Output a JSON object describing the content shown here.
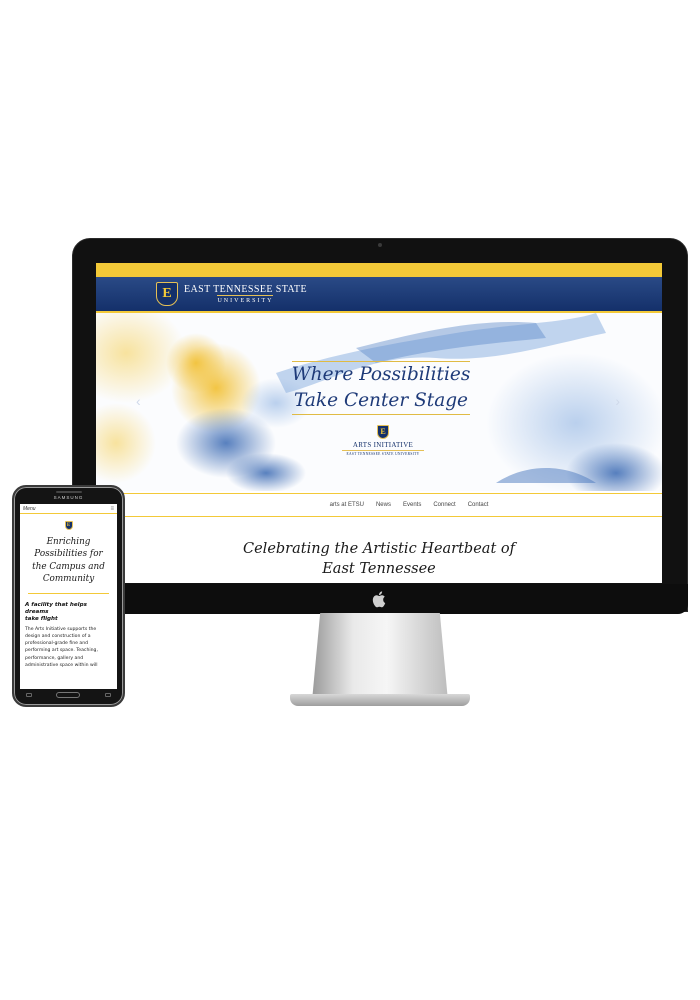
{
  "desktop_site": {
    "logo": {
      "mark": "E",
      "name": "EAST TENNESSEE STATE",
      "university": "UNIVERSITY"
    },
    "hero": {
      "headline_line1": "Where Possibilities",
      "headline_line2": "Take Center Stage",
      "arts_mark": "E",
      "arts_name": "ARTS INITIATIVE",
      "arts_sub": "EAST TENNESSEE STATE UNIVERSITY",
      "prev_arrow": "‹",
      "next_arrow": "›"
    },
    "nav": [
      "arts at ETSU",
      "News",
      "Events",
      "Connect",
      "Contact"
    ],
    "subhead_line1": "Celebrating the Artistic Heartbeat of",
    "subhead_line2": "East Tennessee"
  },
  "phone": {
    "brand": "SAMSUNG",
    "menu_label": "Menu",
    "hamburger": "≡",
    "mark": "E",
    "headline": [
      "Enriching",
      "Possibilities for",
      "the Campus and",
      "Community"
    ],
    "subhead": [
      "A facility that helps dreams",
      "take flight"
    ],
    "body": [
      "The Arts Initiative supports the",
      "design and construction of a",
      "professional-grade fine and",
      "performing art space. Teaching,",
      "performance, gallery and",
      "administrative space within will"
    ]
  },
  "colors": {
    "gold": "#f3c938",
    "navy": "#14306a",
    "headline_blue": "#1e3a78"
  },
  "icons": [
    "apple-logo-icon",
    "hamburger-menu-icon",
    "shield-logo-icon"
  ]
}
